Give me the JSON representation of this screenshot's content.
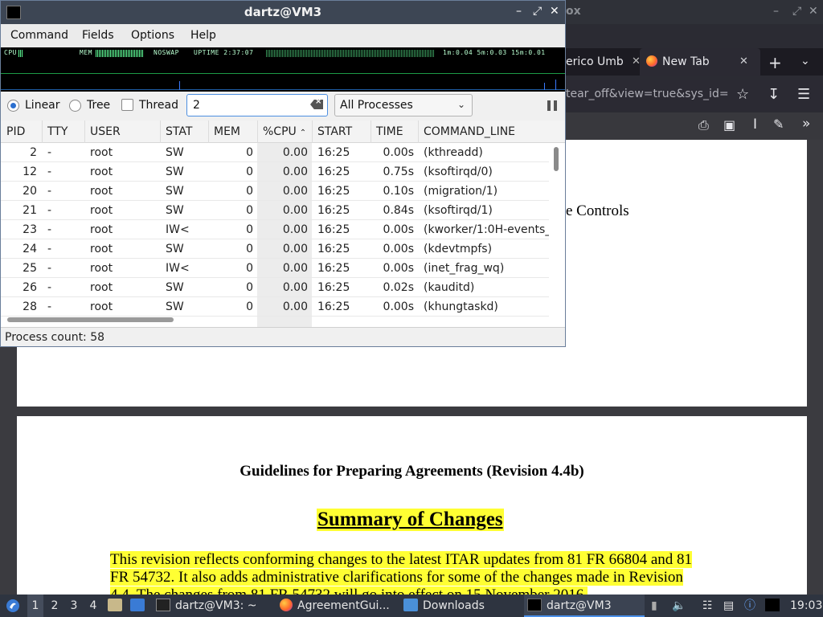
{
  "firefox": {
    "title_fragment": "ox",
    "tabs": [
      {
        "label": "erico Umb"
      },
      {
        "label": "New Tab"
      }
    ],
    "url_fragment": "tear_off&view=true&sys_id=",
    "pdf": {
      "page1_fragment": "e Controls",
      "heading": "Guidelines for Preparing Agreements (Revision 4.4b)",
      "summary_title": "Summary of Changes",
      "paragraph_lines": [
        "This revision reflects conforming changes to the latest ITAR updates from 81 FR 66804 and 81",
        "FR 54732.  It also adds administrative clarifications for some of the changes made in Revision",
        "4.4.  The changes from 81 FR 54732 will go into effect on 15 November 2016."
      ]
    }
  },
  "htop": {
    "title": "dartz@VM3",
    "menu": [
      "Command",
      "Fields",
      "Options",
      "Help"
    ],
    "graph": {
      "cpu_label": "CPU",
      "mem_label": "MEM",
      "swap_label": "NOSWAP",
      "uptime_label": "UPTIME 2:37:07",
      "load_label": "1m:0.04 5m:0.03 15m:0.01"
    },
    "view_modes": {
      "linear": "Linear",
      "tree": "Tree",
      "thread": "Thread",
      "selected": "linear",
      "thread_checked": false
    },
    "filter_value": "2",
    "process_filter": "All Processes",
    "columns": [
      "PID",
      "TTY",
      "USER",
      "STAT",
      "MEM",
      "%CPU",
      "START",
      "TIME",
      "COMMAND_LINE"
    ],
    "sort_column": "%CPU",
    "rows": [
      {
        "pid": "2",
        "tty": "-",
        "user": "root",
        "stat": "SW",
        "mem": "0",
        "cpu": "0.00",
        "start": "16:25",
        "time": "0.00s",
        "cmd": "(kthreadd)"
      },
      {
        "pid": "12",
        "tty": "-",
        "user": "root",
        "stat": "SW",
        "mem": "0",
        "cpu": "0.00",
        "start": "16:25",
        "time": "0.75s",
        "cmd": "(ksoftirqd/0)"
      },
      {
        "pid": "20",
        "tty": "-",
        "user": "root",
        "stat": "SW",
        "mem": "0",
        "cpu": "0.00",
        "start": "16:25",
        "time": "0.10s",
        "cmd": "(migration/1)"
      },
      {
        "pid": "21",
        "tty": "-",
        "user": "root",
        "stat": "SW",
        "mem": "0",
        "cpu": "0.00",
        "start": "16:25",
        "time": "0.84s",
        "cmd": "(ksoftirqd/1)"
      },
      {
        "pid": "23",
        "tty": "-",
        "user": "root",
        "stat": "IW<",
        "mem": "0",
        "cpu": "0.00",
        "start": "16:25",
        "time": "0.00s",
        "cmd": "(kworker/1:0H-events_"
      },
      {
        "pid": "24",
        "tty": "-",
        "user": "root",
        "stat": "SW",
        "mem": "0",
        "cpu": "0.00",
        "start": "16:25",
        "time": "0.00s",
        "cmd": "(kdevtmpfs)"
      },
      {
        "pid": "25",
        "tty": "-",
        "user": "root",
        "stat": "IW<",
        "mem": "0",
        "cpu": "0.00",
        "start": "16:25",
        "time": "0.00s",
        "cmd": "(inet_frag_wq)"
      },
      {
        "pid": "26",
        "tty": "-",
        "user": "root",
        "stat": "SW",
        "mem": "0",
        "cpu": "0.00",
        "start": "16:25",
        "time": "0.02s",
        "cmd": "(kauditd)"
      },
      {
        "pid": "28",
        "tty": "-",
        "user": "root",
        "stat": "SW",
        "mem": "0",
        "cpu": "0.00",
        "start": "16:25",
        "time": "0.00s",
        "cmd": "(khungtaskd)"
      }
    ],
    "status": "Process count: 58"
  },
  "taskbar": {
    "workspaces": [
      "1",
      "2",
      "3",
      "4"
    ],
    "active_workspace": "1",
    "windows": [
      {
        "label": "dartz@VM3: ~",
        "icon": "terminal-icon"
      },
      {
        "label": "AgreementGui...",
        "icon": "firefox-icon"
      },
      {
        "label": "Downloads",
        "icon": "folder-icon"
      },
      {
        "label": "dartz@VM3",
        "icon": "task-manager-icon"
      }
    ],
    "clock": "19:03"
  },
  "colors": {
    "highlight": "#ffff33",
    "titlebar": "#3d4654",
    "taskbar": "#2e3440",
    "graph_green": "#60ff98"
  }
}
